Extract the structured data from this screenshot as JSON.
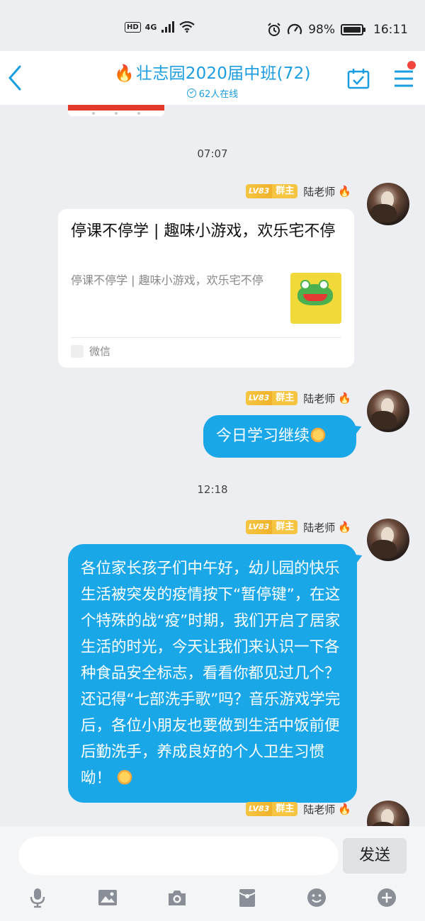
{
  "status": {
    "hd": "HD",
    "network": "4G",
    "battery": "98%",
    "battery_level": 0.98,
    "time": "16:11"
  },
  "header": {
    "title_flame": "🔥",
    "title": "壮志园2020届中班(72)",
    "online": "62人在线"
  },
  "chat": {
    "timestamps": [
      "07:07",
      "12:18"
    ],
    "sender": {
      "level": "LV83",
      "role": "群主",
      "name": "陆老师",
      "flame": "🔥"
    },
    "card": {
      "title": "停课不停学 | 趣味小游戏，欢乐宅不停",
      "desc": "停课不停学 | 趣味小游戏，欢乐宅不停",
      "source": "微信"
    },
    "msg1": "今日学习继续",
    "msg2": "各位家长孩子们中午好，幼儿园的快乐生活被突发的疫情按下“暂停键”，在这个特殊的战“疫”时期，我们开启了居家生活的时光，今天让我们来认识一下各种食品安全标志，看看你都见过几个？还记得“七部洗手歌”吗？音乐游戏学完后，各位小朋友也要做到生活中饭前便后勤洗手，养成良好的个人卫生习惯呦！"
  },
  "input": {
    "placeholder": "",
    "send_label": "发送"
  },
  "colors": {
    "accent": "#1aa7e8",
    "header_text": "#1a9de0",
    "badge": "#f5c542",
    "notify": "#f1453d"
  },
  "toolbar_icons": [
    "microphone-icon",
    "image-icon",
    "camera-icon",
    "red-packet-icon",
    "emoji-icon",
    "plus-icon"
  ]
}
